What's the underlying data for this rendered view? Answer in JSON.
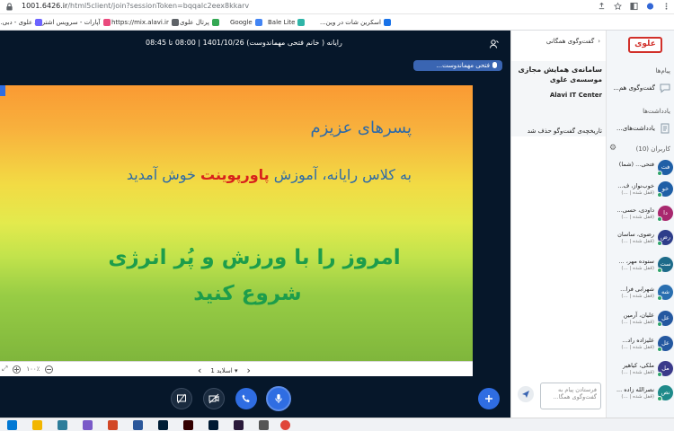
{
  "browser": {
    "url_host": "1001.6426.ir",
    "url_path": "/html5client/join?sessionToken=bqqalc2eex8kkarv",
    "bookmarks": [
      {
        "label": "اسکرین شات در وین...",
        "color": "#1a73e8"
      },
      {
        "label": "Bale Lite",
        "color": "#2fb5a8"
      },
      {
        "label": "Google",
        "color": "#4285f4"
      },
      {
        "label": "پرتال علوی",
        "color": "#34a853"
      },
      {
        "label": "https://mix.alavi.ir",
        "color": "#5f6368"
      },
      {
        "label": "آپارات - سرویس اشترا...",
        "color": "#ea4b7e"
      },
      {
        "label": "علوی - دبی...",
        "color": "#6c63ff"
      }
    ]
  },
  "session": {
    "title": "رایانه ( خانم فتحی مهماندوست) 1401/10/26 | 08:00 تا 08:45",
    "presenter": "فتحی مهماندوست..."
  },
  "slide": {
    "line1": "پسرهای عزیزم",
    "line2_before": "به کلاس رایانه، آموزش ",
    "line2_highlight": "پاورپوینت",
    "line2_after": " خوش آمدید",
    "line3": "امروز را با ورزش و پُر انرژی",
    "line4": "شروع کنید"
  },
  "slide_toolbar": {
    "zoom": "۱۰۰٪",
    "slide_label": "اسلاید 1",
    "prev": "‹",
    "next": "›",
    "dropdown": "▾"
  },
  "chat": {
    "header": "گفت‌وگوی همگانی",
    "chevron": "‹",
    "welcome_line1": "سامانه‌ی همایش مجازی",
    "welcome_line2": "موسسه‌ی علوی",
    "welcome_line3": "Alavi IT Center",
    "clear_msg": "تاریخچه‌ی گفت‌وگو حذف شد",
    "input_placeholder": "فرستادن پیام به گفت‌وگوی همگا..."
  },
  "userlist": {
    "logo": "علوی",
    "messages_section": "پیام‌ها",
    "public_chat": "گفت‌وگوی هم...",
    "notes_section": "یادداشت‌ها",
    "shared_notes": "یادداشت‌های...",
    "users_section": "کاربران (10)",
    "users": [
      {
        "initials": "فت",
        "name": "فتحی... (شما)",
        "sub": "",
        "color": "#1f5fa6"
      },
      {
        "initials": "خو",
        "name": "خوب‌نواز، ف...",
        "sub": "(قفل شده | ...)",
        "color": "#1f5fa6"
      },
      {
        "initials": "دا",
        "name": "داودی، حسی...",
        "sub": "(قفل شده | ...)",
        "color": "#a8286e"
      },
      {
        "initials": "رض",
        "name": "رضوی، ساسان",
        "sub": "(قفل شده | ...)",
        "color": "#2e3d8a"
      },
      {
        "initials": "ست",
        "name": "ستوده مهر، ...",
        "sub": "(قفل شده | ...)",
        "color": "#1d6b8a"
      },
      {
        "initials": "شه",
        "name": "شهرابی فرا...",
        "sub": "(قفل شده | ...)",
        "color": "#2a6fb0"
      },
      {
        "initials": "عل",
        "name": "علیان، آرمین",
        "sub": "(قفل شده | ...)",
        "color": "#2458a0"
      },
      {
        "initials": "عل",
        "name": "علیزاده راد...",
        "sub": "(قفل شده | ...)",
        "color": "#2458a0"
      },
      {
        "initials": "مل",
        "name": "ملکی، کیاهیر",
        "sub": "(قفل شده | ...)",
        "color": "#3a3a8a"
      },
      {
        "initials": "نص",
        "name": "نصرالله زاده ...",
        "sub": "(قفل شده | ...)",
        "color": "#1f8a8a"
      }
    ]
  },
  "colors": {
    "stage_bg": "#06172a",
    "accent_blue": "#2f6de2",
    "slide_text_blue": "#2d6aa8",
    "slide_text_red": "#d8211c",
    "slide_text_green": "#1d9d4b"
  }
}
